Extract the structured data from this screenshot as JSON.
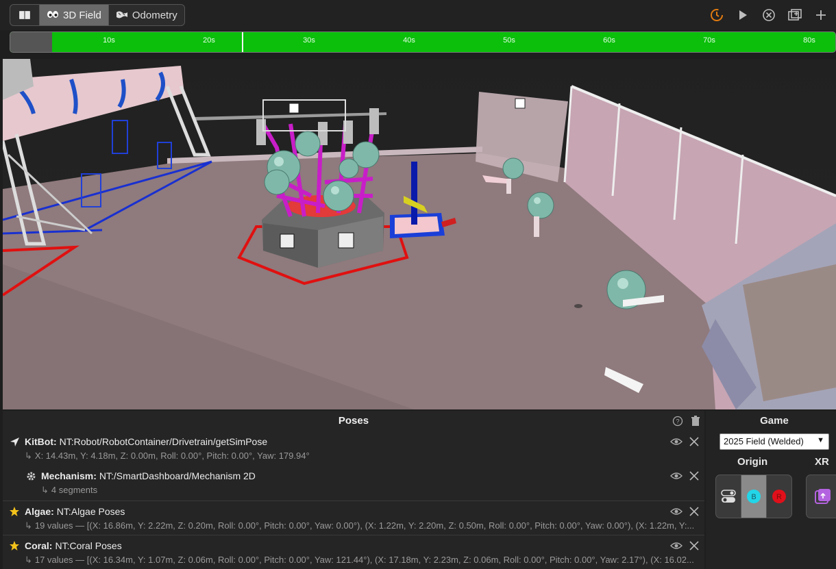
{
  "tabs": [
    {
      "label": "",
      "icon": "book-icon"
    },
    {
      "label": "3D Field",
      "icon": "eyes-icon"
    },
    {
      "label": "Odometry",
      "icon": "map-icon"
    }
  ],
  "toolbar": {
    "icons": [
      "sync-icon",
      "play-icon",
      "close-circle-icon",
      "add-window-icon",
      "plus-icon"
    ],
    "accent": "#e07a10"
  },
  "timeline": {
    "ticks": [
      "10s",
      "20s",
      "30s",
      "40s",
      "50s",
      "60s",
      "70s",
      "80s"
    ],
    "color": "#0bbf0b"
  },
  "poses": {
    "title": "Poses",
    "items": [
      {
        "label": "KitBot:",
        "source": "NT:Robot/RobotContainer/Drivetrain/getSimPose",
        "detail": "X: 14.43m, Y: 4.18m, Z: 0.00m, Roll: 0.00°, Pitch: 0.00°, Yaw: 179.94°",
        "icon": "navigation-arrow-icon"
      },
      {
        "label": "Mechanism:",
        "source": "NT:/SmartDashboard/Mechanism 2D",
        "detail": "4 segments",
        "icon": "gear-icon"
      },
      {
        "label": "Algae:",
        "source": "NT:Algae Poses",
        "detail": "19 values — [(X: 16.86m, Y: 2.22m, Z: 0.20m, Roll: 0.00°, Pitch: 0.00°, Yaw: 0.00°), (X: 1.22m, Y: 2.20m, Z: 0.50m, Roll: 0.00°, Pitch: 0.00°, Yaw: 0.00°), (X: 1.22m, Y:...",
        "icon": "star-icon"
      },
      {
        "label": "Coral:",
        "source": "NT:Coral Poses",
        "detail": "17 values — [(X: 16.34m, Y: 1.07m, Z: 0.06m, Roll: 0.00°, Pitch: 0.00°, Yaw: 121.44°), (X: 17.18m, Y: 2.23m, Z: 0.06m, Roll: 0.00°, Pitch: 0.00°, Yaw: 2.17°), (X: 16.02...",
        "icon": "star-icon"
      }
    ]
  },
  "game": {
    "title": "Game",
    "selected": "2025 Field (Welded)",
    "origin_title": "Origin",
    "xr_title": "XR",
    "origin_options": [
      "toggle-icon",
      "B",
      "R"
    ]
  }
}
